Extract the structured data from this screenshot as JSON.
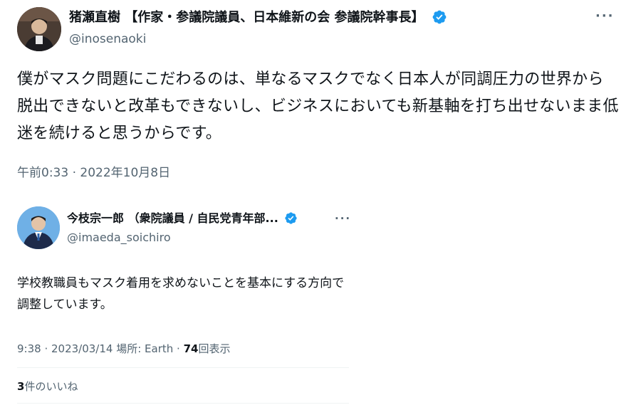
{
  "main_tweet": {
    "author_name": "猪瀬直樹 【作家・参議院議員、日本維新の会 参議院幹事長】",
    "author_handle": "@inosenaoki",
    "text": "僕がマスク問題にこだわるのは、単なるマスクでなく日本人が同調圧力の世界から脱出できないと改革もできないし、ビジネスにおいても新基軸を打ち出せないまま低迷を続けると思うからです。",
    "timestamp": "午前0:33 · 2022年10月8日",
    "more_label": "···"
  },
  "quoted_tweet": {
    "author_name": "今枝宗一郎 （衆院議員 / 自民党青年部...",
    "author_handle": "@imaeda_soichiro",
    "text": "学校教職員もマスク着用を求めないことを基本にする方向で調整しています。",
    "meta_prefix": "9:38 · 2023/03/14 場所: Earth · ",
    "views_count": "74",
    "views_label": "回表示",
    "likes_count": "3",
    "likes_label": "件のいいね",
    "more_label": "···"
  },
  "colors": {
    "verified": "#1d9bf0",
    "secondary_text": "#536471",
    "divider": "#eff3f4"
  }
}
